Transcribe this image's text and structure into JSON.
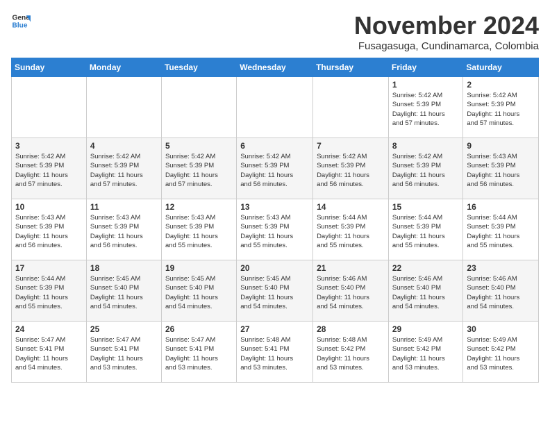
{
  "header": {
    "logo_line1": "General",
    "logo_line2": "Blue",
    "month_title": "November 2024",
    "location": "Fusagasuga, Cundinamarca, Colombia"
  },
  "days_of_week": [
    "Sunday",
    "Monday",
    "Tuesday",
    "Wednesday",
    "Thursday",
    "Friday",
    "Saturday"
  ],
  "weeks": [
    [
      {
        "day": "",
        "info": ""
      },
      {
        "day": "",
        "info": ""
      },
      {
        "day": "",
        "info": ""
      },
      {
        "day": "",
        "info": ""
      },
      {
        "day": "",
        "info": ""
      },
      {
        "day": "1",
        "info": "Sunrise: 5:42 AM\nSunset: 5:39 PM\nDaylight: 11 hours\nand 57 minutes."
      },
      {
        "day": "2",
        "info": "Sunrise: 5:42 AM\nSunset: 5:39 PM\nDaylight: 11 hours\nand 57 minutes."
      }
    ],
    [
      {
        "day": "3",
        "info": "Sunrise: 5:42 AM\nSunset: 5:39 PM\nDaylight: 11 hours\nand 57 minutes."
      },
      {
        "day": "4",
        "info": "Sunrise: 5:42 AM\nSunset: 5:39 PM\nDaylight: 11 hours\nand 57 minutes."
      },
      {
        "day": "5",
        "info": "Sunrise: 5:42 AM\nSunset: 5:39 PM\nDaylight: 11 hours\nand 57 minutes."
      },
      {
        "day": "6",
        "info": "Sunrise: 5:42 AM\nSunset: 5:39 PM\nDaylight: 11 hours\nand 56 minutes."
      },
      {
        "day": "7",
        "info": "Sunrise: 5:42 AM\nSunset: 5:39 PM\nDaylight: 11 hours\nand 56 minutes."
      },
      {
        "day": "8",
        "info": "Sunrise: 5:42 AM\nSunset: 5:39 PM\nDaylight: 11 hours\nand 56 minutes."
      },
      {
        "day": "9",
        "info": "Sunrise: 5:43 AM\nSunset: 5:39 PM\nDaylight: 11 hours\nand 56 minutes."
      }
    ],
    [
      {
        "day": "10",
        "info": "Sunrise: 5:43 AM\nSunset: 5:39 PM\nDaylight: 11 hours\nand 56 minutes."
      },
      {
        "day": "11",
        "info": "Sunrise: 5:43 AM\nSunset: 5:39 PM\nDaylight: 11 hours\nand 56 minutes."
      },
      {
        "day": "12",
        "info": "Sunrise: 5:43 AM\nSunset: 5:39 PM\nDaylight: 11 hours\nand 55 minutes."
      },
      {
        "day": "13",
        "info": "Sunrise: 5:43 AM\nSunset: 5:39 PM\nDaylight: 11 hours\nand 55 minutes."
      },
      {
        "day": "14",
        "info": "Sunrise: 5:44 AM\nSunset: 5:39 PM\nDaylight: 11 hours\nand 55 minutes."
      },
      {
        "day": "15",
        "info": "Sunrise: 5:44 AM\nSunset: 5:39 PM\nDaylight: 11 hours\nand 55 minutes."
      },
      {
        "day": "16",
        "info": "Sunrise: 5:44 AM\nSunset: 5:39 PM\nDaylight: 11 hours\nand 55 minutes."
      }
    ],
    [
      {
        "day": "17",
        "info": "Sunrise: 5:44 AM\nSunset: 5:39 PM\nDaylight: 11 hours\nand 55 minutes."
      },
      {
        "day": "18",
        "info": "Sunrise: 5:45 AM\nSunset: 5:40 PM\nDaylight: 11 hours\nand 54 minutes."
      },
      {
        "day": "19",
        "info": "Sunrise: 5:45 AM\nSunset: 5:40 PM\nDaylight: 11 hours\nand 54 minutes."
      },
      {
        "day": "20",
        "info": "Sunrise: 5:45 AM\nSunset: 5:40 PM\nDaylight: 11 hours\nand 54 minutes."
      },
      {
        "day": "21",
        "info": "Sunrise: 5:46 AM\nSunset: 5:40 PM\nDaylight: 11 hours\nand 54 minutes."
      },
      {
        "day": "22",
        "info": "Sunrise: 5:46 AM\nSunset: 5:40 PM\nDaylight: 11 hours\nand 54 minutes."
      },
      {
        "day": "23",
        "info": "Sunrise: 5:46 AM\nSunset: 5:40 PM\nDaylight: 11 hours\nand 54 minutes."
      }
    ],
    [
      {
        "day": "24",
        "info": "Sunrise: 5:47 AM\nSunset: 5:41 PM\nDaylight: 11 hours\nand 54 minutes."
      },
      {
        "day": "25",
        "info": "Sunrise: 5:47 AM\nSunset: 5:41 PM\nDaylight: 11 hours\nand 53 minutes."
      },
      {
        "day": "26",
        "info": "Sunrise: 5:47 AM\nSunset: 5:41 PM\nDaylight: 11 hours\nand 53 minutes."
      },
      {
        "day": "27",
        "info": "Sunrise: 5:48 AM\nSunset: 5:41 PM\nDaylight: 11 hours\nand 53 minutes."
      },
      {
        "day": "28",
        "info": "Sunrise: 5:48 AM\nSunset: 5:42 PM\nDaylight: 11 hours\nand 53 minutes."
      },
      {
        "day": "29",
        "info": "Sunrise: 5:49 AM\nSunset: 5:42 PM\nDaylight: 11 hours\nand 53 minutes."
      },
      {
        "day": "30",
        "info": "Sunrise: 5:49 AM\nSunset: 5:42 PM\nDaylight: 11 hours\nand 53 minutes."
      }
    ]
  ]
}
